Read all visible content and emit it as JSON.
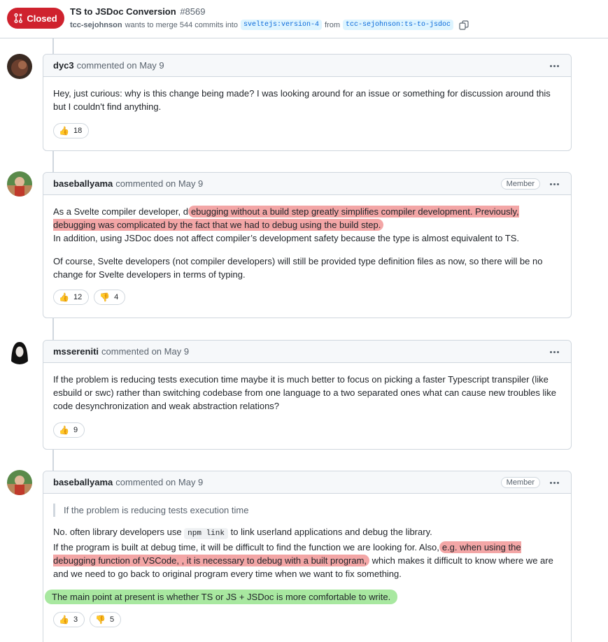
{
  "header": {
    "state_label": "Closed",
    "title": "TS to JSDoc Conversion",
    "number": "#8569",
    "author": "tcc-sejohnson",
    "merge_text": "wants to merge 544 commits into",
    "base_branch": "sveltejs:version-4",
    "from_text": "from",
    "head_branch": "tcc-sejohnson:ts-to-jsdoc"
  },
  "comments": [
    {
      "user": "dyc3",
      "meta": "commented on May 9",
      "body": "Hey, just curious: why is this change being made? I was looking around for an issue or something for discussion around this but I couldn't find anything.",
      "reactions": [
        {
          "emoji": "👍",
          "count": "18"
        }
      ]
    },
    {
      "user": "baseballyama",
      "meta": "commented on May 9",
      "badge": "Member",
      "p1_pre": "As a Svelte compiler developer, d",
      "p1_hl": "ebugging without a build step greatly simplifies compiler development. Previously, debugging was complicated by the fact that we had to debug using the build step.",
      "p1_post": "In addition, using JSDoc does not affect compiler’s development safety because the type is almost equivalent to TS.",
      "p2": "Of course, Svelte developers (not compiler developers) will still be provided type definition files as now, so there will be no change for Svelte developers in terms of typing.",
      "reactions": [
        {
          "emoji": "👍",
          "count": "12"
        },
        {
          "emoji": "👎",
          "count": "4"
        }
      ]
    },
    {
      "user": "mssereniti",
      "meta": "commented on May 9",
      "body": "If the problem is reducing tests execution time maybe it is much better to focus on picking a faster Typescript transpiler (like esbuild or swc) rather than switching codebase from one language to a two separated ones what can cause new troubles like code desynchronization and weak abstraction relations?",
      "reactions": [
        {
          "emoji": "👍",
          "count": "9"
        }
      ]
    },
    {
      "user": "baseballyama",
      "meta": "commented on May 9",
      "badge": "Member",
      "quote": "If the problem is reducing tests execution time",
      "p1_pre": "No. often library developers use",
      "p1_code": "npm link",
      "p1_post": "to link userland applications and debug the library.",
      "p2_pre": "If the program is built at debug time, it will be difficult to find the function we are looking for. Also,",
      "p2_hl": "e.g. when using the debugging function of VSCode, , it is necessary to debug with a built program,",
      "p2_post": "which makes it difficult to know where we are and we need to go back to original program every time when we want to fix something.",
      "p3": "The main point at present is whether TS or JS + JSDoc is more comfortable to write.",
      "reactions": [
        {
          "emoji": "👍",
          "count": "3"
        },
        {
          "emoji": "👎",
          "count": "5"
        }
      ]
    }
  ]
}
